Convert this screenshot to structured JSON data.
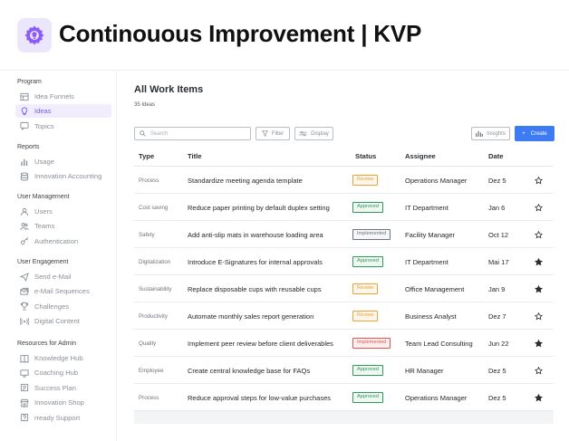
{
  "app": {
    "title": "Continouous Improvement | KVP"
  },
  "sidebar": {
    "sections": [
      {
        "title": "Program",
        "items": [
          {
            "label": "Idea Funnels",
            "icon": "funnel-grid-icon"
          },
          {
            "label": "Ideas",
            "icon": "lightbulb-icon",
            "active": true
          },
          {
            "label": "Topics",
            "icon": "chat-icon"
          }
        ]
      },
      {
        "title": "Reports",
        "items": [
          {
            "label": "Usage",
            "icon": "bar-chart-icon"
          },
          {
            "label": "Innovation Accounting",
            "icon": "database-icon"
          }
        ]
      },
      {
        "title": "User Management",
        "items": [
          {
            "label": "Users",
            "icon": "user-icon"
          },
          {
            "label": "Teams",
            "icon": "team-icon"
          },
          {
            "label": "Authentication",
            "icon": "key-icon"
          }
        ]
      },
      {
        "title": "User Engagement",
        "items": [
          {
            "label": "Send e-Mail",
            "icon": "send-icon"
          },
          {
            "label": "e-Mail Sequences",
            "icon": "mail-sequence-icon"
          },
          {
            "label": "Challenges",
            "icon": "trophy-icon"
          },
          {
            "label": "Digital Content",
            "icon": "broadcast-icon"
          }
        ]
      },
      {
        "title": "Resources for Admin",
        "items": [
          {
            "label": "Knowledge Hub",
            "icon": "book-icon"
          },
          {
            "label": "Coaching Hub",
            "icon": "coaching-icon"
          },
          {
            "label": "Success Plan",
            "icon": "plan-icon"
          },
          {
            "label": "Innovation Shop",
            "icon": "shop-icon"
          },
          {
            "label": "rready Support",
            "icon": "support-icon"
          }
        ]
      }
    ]
  },
  "main": {
    "title": "All Work Items",
    "count": "35 Ideas",
    "search_placeholder": "Search",
    "filter_label": "Filter",
    "display_label": "Display",
    "insights_label": "Insights",
    "create_label": "Create",
    "columns": [
      "Type",
      "Title",
      "Status",
      "Assignee",
      "Date"
    ],
    "rows": [
      {
        "type": "Process",
        "title": "Standardize meeting agenda template",
        "status": "Review",
        "assignee": "Operations Manager",
        "date": "Dez 5",
        "starred": false
      },
      {
        "type": "Cost saving",
        "title": "Reduce paper printing by default duplex setting",
        "status": "Approved",
        "assignee": "IT Department",
        "date": "Jan 6",
        "starred": false
      },
      {
        "type": "Safety",
        "title": "Add anti-slip mats in warehouse loading area",
        "status": "Implemented",
        "assignee": "Facility Manager",
        "date": "Oct 12",
        "starred": false
      },
      {
        "type": "Digitalization",
        "title": "Introduce E-Signatures for internal approvals",
        "status": "Approved",
        "assignee": "IT Department",
        "date": "Mai 17",
        "starred": true
      },
      {
        "type": "Sustainability",
        "title": "Replace disposable cups with reusable cups",
        "status": "Review",
        "assignee": "Office Management",
        "date": "Jan 9",
        "starred": true
      },
      {
        "type": "Productivity",
        "title": "Automate monthly sales report generation",
        "status": "Review",
        "assignee": "Business Analyst",
        "date": "Dez 7",
        "starred": false
      },
      {
        "type": "Quality",
        "title": "Implement peer review before client deliverables",
        "status": "Implemented",
        "status_variant": "danger",
        "assignee": "Team Lead Consulting",
        "date": "Jun 22",
        "starred": true
      },
      {
        "type": "Employee",
        "title": "Create central knowledge base for FAQs",
        "status": "Approved",
        "assignee": "HR Manager",
        "date": "Dez 5",
        "starred": false
      },
      {
        "type": "Process",
        "title": "Reduce approval steps for low-value purchases",
        "status": "Approved",
        "assignee": "Operations Manager",
        "date": "Dez 5",
        "starred": true
      }
    ]
  },
  "colors": {
    "accent": "#7a5af0",
    "primary_button": "#3d7bf2",
    "review": "#e8a33b",
    "approved": "#2f9a5c",
    "implemented": "#6e747b",
    "implemented_danger": "#e2554f"
  }
}
